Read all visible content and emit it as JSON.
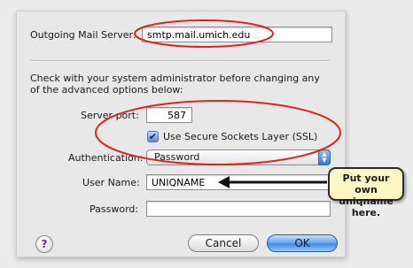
{
  "fields": {
    "outgoing_server_label": "Outgoing Mail Server:",
    "outgoing_server_value": "smtp.mail.umich.edu",
    "advanced_note": "Check with your system administrator before changing any of the advanced options below:",
    "server_port_label": "Server port:",
    "server_port_value": "587",
    "ssl_label": "Use Secure Sockets Layer (SSL)",
    "ssl_checked": true,
    "authentication_label": "Authentication:",
    "authentication_value": "Password",
    "username_label": "User Name:",
    "username_value": "UNIQNAME",
    "password_label": "Password:",
    "password_value": ""
  },
  "buttons": {
    "help": "?",
    "cancel": "Cancel",
    "ok": "OK"
  },
  "callout": {
    "line1": "Put your own",
    "line2": "uniqname here."
  },
  "icons": {
    "checkbox": "checkmark-icon",
    "popup": "updown-arrows-icon",
    "help": "question-icon",
    "pointer": "arrow-left-icon"
  },
  "colors": {
    "highlight_ellipse": "#e0241b",
    "callout_bg": "#fdf7c5",
    "ok_button": "#3d8ae6"
  }
}
